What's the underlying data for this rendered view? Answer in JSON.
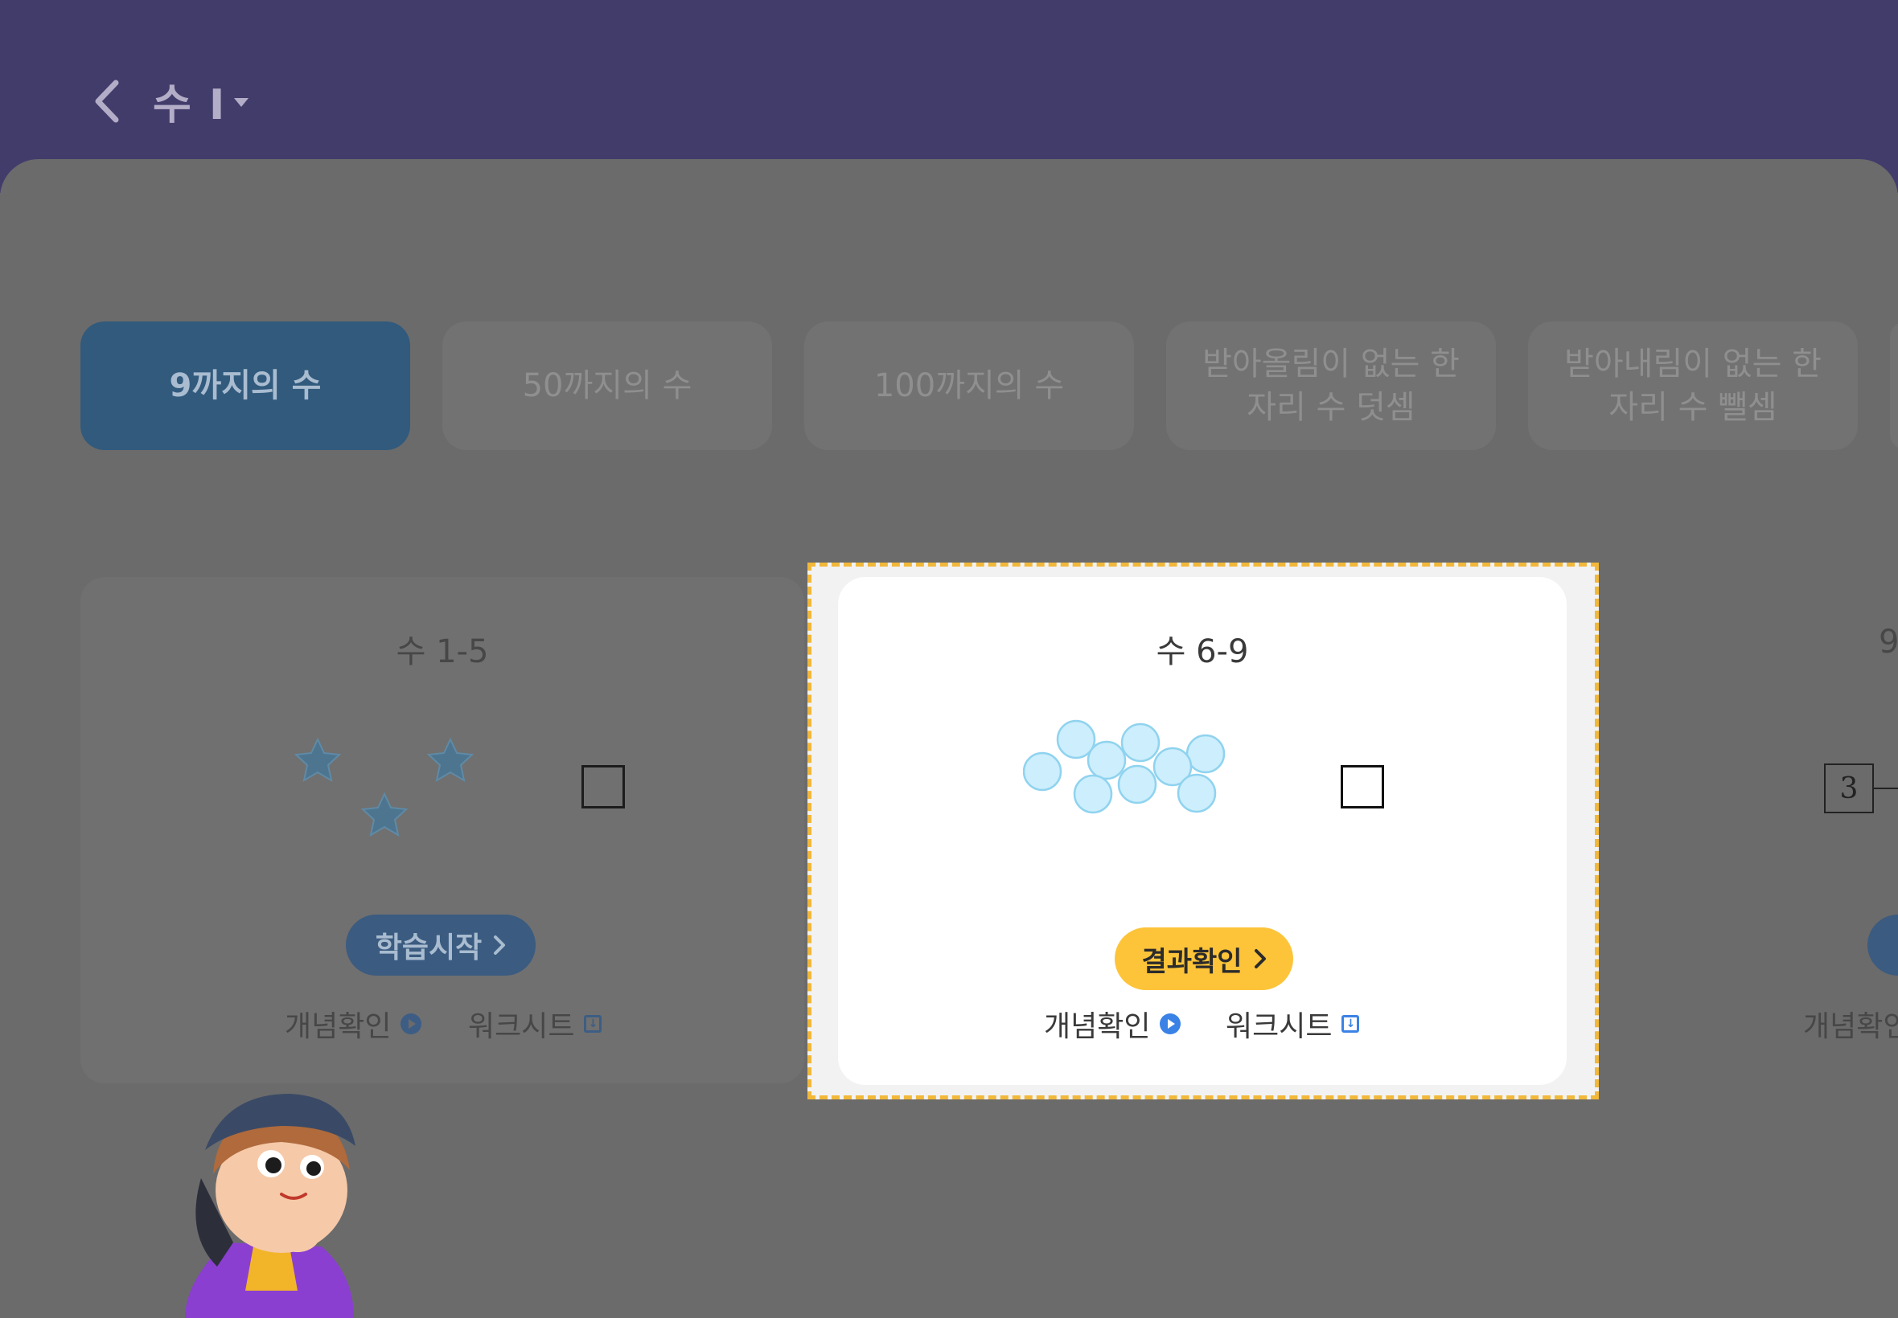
{
  "header": {
    "title": "수 I"
  },
  "tabs": [
    {
      "label": "9까지의 수",
      "active": true
    },
    {
      "label": "50까지의 수",
      "active": false
    },
    {
      "label": "100까지의 수",
      "active": false
    },
    {
      "label_line1": "받아올림이 없는 한",
      "label_line2": "자리 수 덧셈",
      "active": false
    },
    {
      "label_line1": "받아내림이 없는 한",
      "label_line2": "자리 수 뺄셈",
      "active": false
    }
  ],
  "cards": [
    {
      "title": "수 1-5",
      "button": "학습시작",
      "concept_link": "개념확인",
      "worksheet_link": "워크시트",
      "star_count": 3
    },
    {
      "title": "수 6-9",
      "button": "결과확인",
      "concept_link": "개념확인",
      "worksheet_link": "워크시트",
      "circle_count": 9
    },
    {
      "title": "9",
      "number_box": "3",
      "concept_link": "개념확인"
    }
  ],
  "colors": {
    "header": "#423c6b",
    "active_tab": "#315a7d",
    "result_button": "#fdc43a",
    "highlight_border": "#f2b83a",
    "circle_fill": "#cdeefc",
    "circle_stroke": "#8fd3ef"
  }
}
